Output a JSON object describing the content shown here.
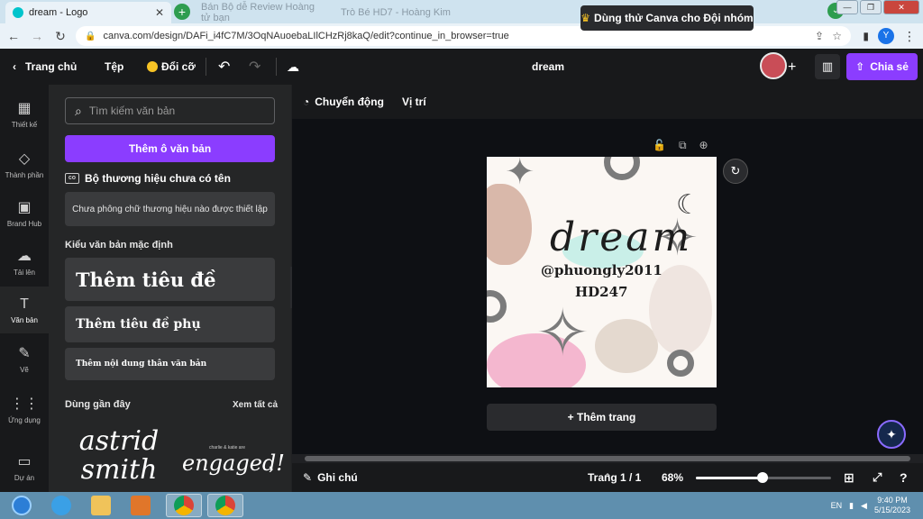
{
  "browser": {
    "active_tab_title": "dream - Logo",
    "bg_tab_1": "Bán Bộ dễ Review Hoàng tử bạn",
    "bg_tab_2": "Trò Bé  HD7 - Hoàng Kim",
    "url": "canva.com/design/DAFi_i4fC7M/3OqNAuoebaLIlCHzRj8kaQ/edit?continue_in_browser=true",
    "profile_letter": "Y"
  },
  "topbar": {
    "home": "Trang chủ",
    "file": "Tệp",
    "resize": "Đổi cỡ",
    "design_name": "dream",
    "try_teams": "Dùng thử Canva cho Đội nhóm",
    "share": "Chia sẻ"
  },
  "rail": {
    "items": [
      {
        "label": "Thiết kế",
        "icon": "layout-icon"
      },
      {
        "label": "Thành phần",
        "icon": "elements-icon"
      },
      {
        "label": "Brand Hub",
        "icon": "brand-icon"
      },
      {
        "label": "Tải lên",
        "icon": "upload-icon"
      },
      {
        "label": "Văn bản",
        "icon": "text-icon"
      },
      {
        "label": "Vẽ",
        "icon": "draw-icon"
      },
      {
        "label": "Ứng dụng",
        "icon": "apps-icon"
      },
      {
        "label": "Dự án",
        "icon": "folder-icon"
      }
    ]
  },
  "panel": {
    "search_placeholder": "Tìm kiếm văn bản",
    "add_textbox": "Thêm ô văn bản",
    "brand_kit": "Bộ thương hiệu chưa có tên",
    "no_brand_fonts": "Chưa phông chữ thương hiệu nào được thiết lập",
    "default_styles": "Kiểu văn bản mặc định",
    "add_heading": "Thêm tiêu đề",
    "add_subheading": "Thêm tiêu đề phụ",
    "add_body": "Thêm nội dung thân văn bản",
    "recently_used": "Dùng gần đây",
    "see_all": "Xem tất cả",
    "recent_1_line1": "astrid",
    "recent_1_line2": "smith",
    "recent_2_small": "charlie & katie are",
    "recent_2_big": "engaged!"
  },
  "context": {
    "animate": "Chuyển động",
    "position": "Vị trí"
  },
  "canvas": {
    "title": "dream",
    "handle": "@phuongly2011",
    "code": "HD247",
    "add_page": "+ Thêm trang"
  },
  "bottom": {
    "notes": "Ghi chú",
    "page": "Trang 1 / 1",
    "zoom": "68%",
    "zoom_fraction": 0.49
  },
  "taskbar": {
    "lang": "EN",
    "time": "9:40 PM",
    "date": "5/15/2023"
  },
  "colors": {
    "accent": "#8b3dff",
    "canva_bg": "#18191b"
  }
}
